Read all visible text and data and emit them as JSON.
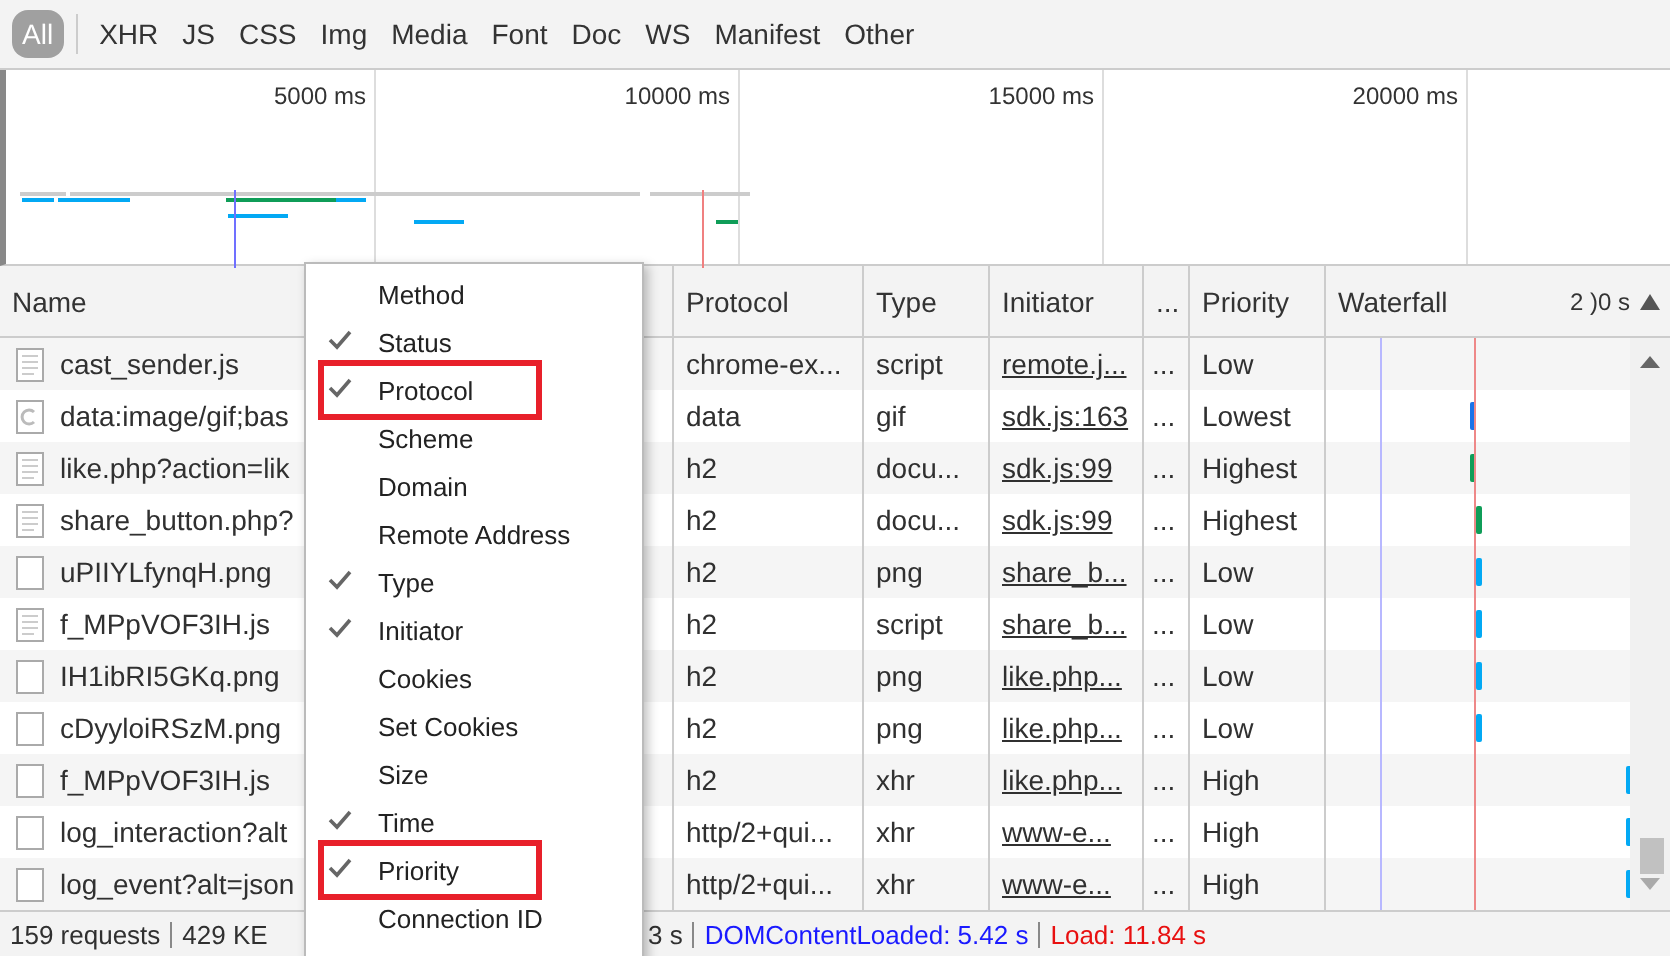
{
  "filters": [
    {
      "label": "All",
      "selected": true
    },
    {
      "label": "XHR",
      "selected": false
    },
    {
      "label": "JS",
      "selected": false
    },
    {
      "label": "CSS",
      "selected": false
    },
    {
      "label": "Img",
      "selected": false
    },
    {
      "label": "Media",
      "selected": false
    },
    {
      "label": "Font",
      "selected": false
    },
    {
      "label": "Doc",
      "selected": false
    },
    {
      "label": "WS",
      "selected": false
    },
    {
      "label": "Manifest",
      "selected": false
    },
    {
      "label": "Other",
      "selected": false
    }
  ],
  "overview": {
    "ticks": [
      "5000 ms",
      "10000 ms",
      "15000 ms",
      "20000 ms"
    ]
  },
  "table": {
    "columns": [
      "Name",
      "Protocol",
      "Type",
      "Initiator",
      "...",
      "Priority",
      "Waterfall"
    ],
    "waterfall_scale": "2 )0 s",
    "rows": [
      {
        "kind": "document",
        "name": "cast_sender.js",
        "protocol": "chrome-ex...",
        "type": "script",
        "initiator": "remote.j...",
        "column_6": "...",
        "priority": "Low"
      },
      {
        "kind": "spinner",
        "name": "data:image/gif;bas",
        "protocol": "data",
        "type": "gif",
        "initiator": "sdk.js:163",
        "column_6": "...",
        "priority": "Lowest",
        "color": "#1a73e8"
      },
      {
        "kind": "document",
        "name": "like.php?action=lik",
        "protocol": "h2",
        "type": "docu...",
        "initiator": "sdk.js:99",
        "column_6": "...",
        "priority": "Highest",
        "color": "#0f9d58"
      },
      {
        "kind": "document",
        "name": "share_button.php?",
        "protocol": "h2",
        "type": "docu...",
        "initiator": "sdk.js:99",
        "column_6": "...",
        "priority": "Highest",
        "color": "#0f9d58"
      },
      {
        "kind": "plain",
        "name": "uPIIYLfynqH.png",
        "protocol": "h2",
        "type": "png",
        "initiator": "share_b...",
        "column_6": "...",
        "priority": "Low",
        "color": "#03a9f4"
      },
      {
        "kind": "document",
        "name": "f_MPpVOF3IH.js",
        "protocol": "h2",
        "type": "script",
        "initiator": "share_b...",
        "column_6": "...",
        "priority": "Low",
        "color": "#03a9f4"
      },
      {
        "kind": "plain",
        "name": "IH1ibRI5GKq.png",
        "protocol": "h2",
        "type": "png",
        "initiator": "like.php...",
        "column_6": "...",
        "priority": "Low",
        "color": "#03a9f4"
      },
      {
        "kind": "plain",
        "name": "cDyyloiRSzM.png",
        "protocol": "h2",
        "type": "png",
        "initiator": "like.php...",
        "column_6": "...",
        "priority": "Low",
        "color": "#03a9f4"
      },
      {
        "kind": "plain",
        "name": "f_MPpVOF3IH.js",
        "protocol": "h2",
        "type": "xhr",
        "initiator": "like.php...",
        "column_6": "...",
        "priority": "High",
        "color": "#03a9f4"
      },
      {
        "kind": "plain",
        "name": "log_interaction?alt",
        "protocol": "http/2+qui...",
        "type": "xhr",
        "initiator": "www-e...",
        "column_6": "...",
        "priority": "High",
        "color": "#03a9f4"
      },
      {
        "kind": "plain",
        "name": "log_event?alt=json",
        "protocol": "http/2+qui...",
        "type": "xhr",
        "initiator": "www-e...",
        "column_6": "...",
        "priority": "High",
        "color": "#03a9f4"
      }
    ]
  },
  "menu": [
    {
      "label": "Method",
      "checked": false,
      "highlighted": false
    },
    {
      "label": "Status",
      "checked": true,
      "highlighted": false
    },
    {
      "label": "Protocol",
      "checked": true,
      "highlighted": true
    },
    {
      "label": "Scheme",
      "checked": false,
      "highlighted": false
    },
    {
      "label": "Domain",
      "checked": false,
      "highlighted": false
    },
    {
      "label": "Remote Address",
      "checked": false,
      "highlighted": false
    },
    {
      "label": "Type",
      "checked": true,
      "highlighted": false
    },
    {
      "label": "Initiator",
      "checked": true,
      "highlighted": false
    },
    {
      "label": "Cookies",
      "checked": false,
      "highlighted": false
    },
    {
      "label": "Set Cookies",
      "checked": false,
      "highlighted": false
    },
    {
      "label": "Size",
      "checked": false,
      "highlighted": false
    },
    {
      "label": "Time",
      "checked": true,
      "highlighted": false
    },
    {
      "label": "Priority",
      "checked": true,
      "highlighted": true
    },
    {
      "label": "Connection ID",
      "checked": false,
      "highlighted": false
    }
  ],
  "status_bar": {
    "requests": "159 requests",
    "transferred": "429 KE",
    "finish": "3 s",
    "dom_content_loaded": "DOMContentLoaded: 5.42 s",
    "load": "Load: 11.84 s"
  }
}
